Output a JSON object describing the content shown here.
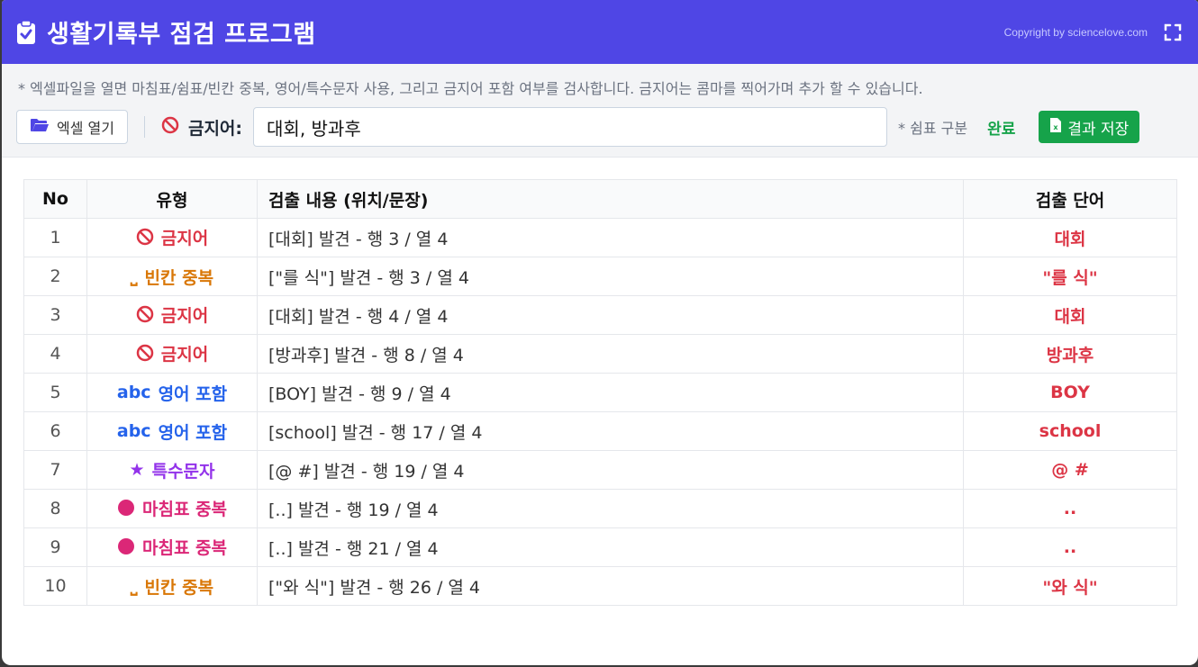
{
  "app": {
    "title": "생활기록부 점검 프로그램",
    "copyright": "Copyright by sciencelove.com"
  },
  "toolbar": {
    "hint": "* 엑셀파일을 열면 마침표/쉼표/빈칸 중복, 영어/특수문자 사용, 그리고 금지어 포함 여부를 검사합니다. 금지어는 콤마를 찍어가며 추가 할 수 있습니다.",
    "open_label": "엑셀 열기",
    "banned_label": "금지어:",
    "banned_value": "대회, 방과후",
    "comma_note": "* 쉼표 구분",
    "status": "완료",
    "save_label": "결과 저장"
  },
  "table": {
    "headers": [
      "No",
      "유형",
      "검출 내용 (위치/문장)",
      "검출 단어"
    ],
    "rows": [
      {
        "no": "1",
        "type": "금지어",
        "icon": "ban-icon",
        "color": "#dc3545",
        "content": "[대회] 발견 - 행 3 / 열 4",
        "word": "대회"
      },
      {
        "no": "2",
        "type": "빈칸 중복",
        "icon": "space-icon",
        "color": "#d97706",
        "content": "[\"를 식\"] 발견 - 행 3 / 열 4",
        "word": "\"를 식\""
      },
      {
        "no": "3",
        "type": "금지어",
        "icon": "ban-icon",
        "color": "#dc3545",
        "content": "[대회] 발견 - 행 4 / 열 4",
        "word": "대회"
      },
      {
        "no": "4",
        "type": "금지어",
        "icon": "ban-icon",
        "color": "#dc3545",
        "content": "[방과후] 발견 - 행 8 / 열 4",
        "word": "방과후"
      },
      {
        "no": "5",
        "type": "영어 포함",
        "icon": "abc-icon",
        "color": "#2563eb",
        "content": "[BOY] 발견 - 행 9 / 열 4",
        "word": "BOY"
      },
      {
        "no": "6",
        "type": "영어 포함",
        "icon": "abc-icon",
        "color": "#2563eb",
        "content": "[school] 발견 - 행 17 / 열 4",
        "word": "school"
      },
      {
        "no": "7",
        "type": "특수문자",
        "icon": "star-icon",
        "color": "#9333ea",
        "content": "[@ #] 발견 - 행 19 / 열 4",
        "word": "@ #"
      },
      {
        "no": "8",
        "type": "마침표 중복",
        "icon": "dot-icon",
        "color": "#db2777",
        "content": "[..] 발견 - 행 19 / 열 4",
        "word": ".."
      },
      {
        "no": "9",
        "type": "마침표 중복",
        "icon": "dot-icon",
        "color": "#db2777",
        "content": "[..] 발견 - 행 21 / 열 4",
        "word": ".."
      },
      {
        "no": "10",
        "type": "빈칸 중복",
        "icon": "space-icon",
        "color": "#d97706",
        "content": "[\"와 식\"] 발견 - 행 26 / 열 4",
        "word": "\"와 식\""
      }
    ]
  },
  "icon_glyphs": {
    "abc-icon": "abc",
    "star-icon": "★",
    "space-icon": "⎵"
  },
  "colors": {
    "header": "#4f46e5",
    "success": "#16a34a",
    "word": "#dc3545"
  }
}
